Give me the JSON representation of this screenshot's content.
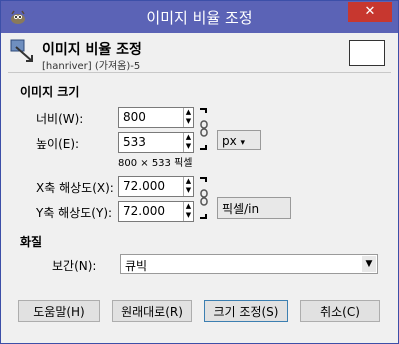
{
  "window": {
    "title": "이미지 비율 조정",
    "close_glyph": "✕"
  },
  "header": {
    "title": "이미지 비율 조정",
    "subtitle": "[hanriver] (가져옴)-5"
  },
  "image_size": {
    "section_label": "이미지 크기",
    "width_label": "너비(W):",
    "width_value": "800",
    "height_label": "높이(E):",
    "height_value": "533",
    "size_note": "800 × 533 픽셀",
    "unit": "px"
  },
  "resolution": {
    "x_label": "X축 해상도(X):",
    "x_value": "72.000",
    "y_label": "Y축 해상도(Y):",
    "y_value": "72.000",
    "unit": "픽셀/in"
  },
  "quality": {
    "section_label": "화질",
    "interp_label": "보간(N):",
    "interp_value": "큐빅"
  },
  "buttons": {
    "help": "도움말(H)",
    "reset": "원래대로(R)",
    "scale": "크기 조정(S)",
    "cancel": "취소(C)"
  },
  "colors": {
    "titlebar": "#5b63b6",
    "close": "#c7372f"
  }
}
